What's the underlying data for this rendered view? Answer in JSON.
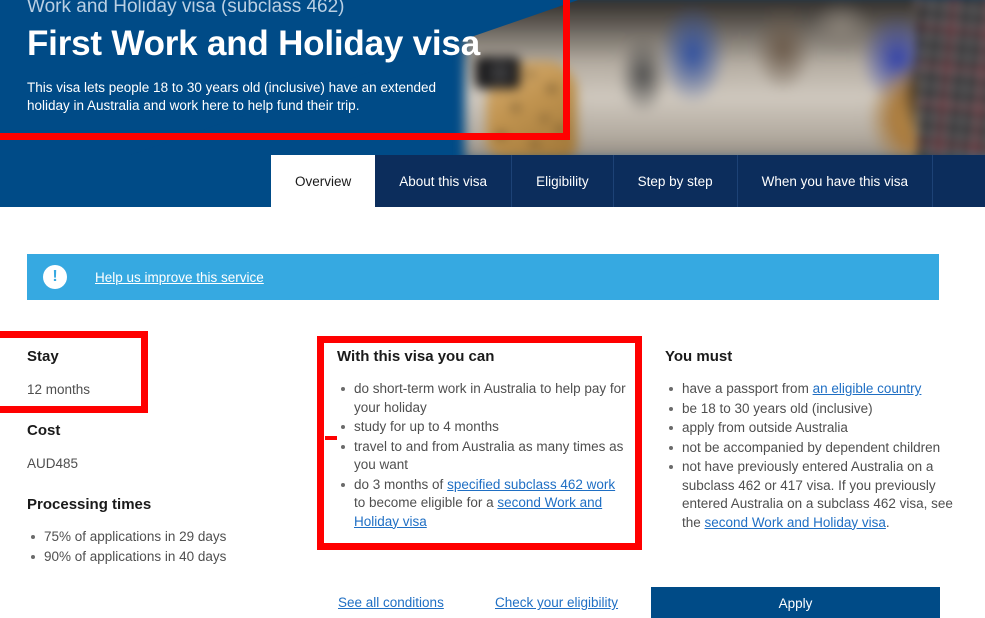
{
  "hero": {
    "eyebrow": "Work and Holiday visa (subclass 462)",
    "title": "First Work and Holiday visa",
    "subtitle": "This visa lets people 18 to 30 years old (inclusive) have an extended holiday in Australia and work here to help fund their trip."
  },
  "tabs": [
    {
      "label": "Overview",
      "active": true
    },
    {
      "label": "About this visa",
      "active": false
    },
    {
      "label": "Eligibility",
      "active": false
    },
    {
      "label": "Step by step",
      "active": false
    },
    {
      "label": "When you have this visa",
      "active": false
    }
  ],
  "alert": {
    "icon": "exclamation-icon",
    "link_label": "Help us improve this service"
  },
  "left_column": {
    "stay_heading": "Stay",
    "stay_value": "12 months",
    "cost_heading": "Cost",
    "cost_value": "AUD485",
    "processing_heading": "Processing times",
    "processing_items": [
      "75% of applications in 29 days",
      "90% of applications in 40 days"
    ]
  },
  "middle_column": {
    "heading": "With this visa you can",
    "items": [
      {
        "pre": "do short-term work in Australia to help pay for your holiday"
      },
      {
        "pre": "study for up to 4 months"
      },
      {
        "pre": "travel to and from Australia as many times as you want"
      },
      {
        "pre": "do 3 months of ",
        "link1": "specified subclass 462 work",
        "mid": " to become eligible for a ",
        "link2": "second Work and Holiday visa"
      }
    ]
  },
  "right_column": {
    "heading": "You must",
    "items": [
      {
        "pre": "have a passport from ",
        "link1": "an eligible country"
      },
      {
        "pre": "be 18 to 30 years old (inclusive)"
      },
      {
        "pre": "apply from outside Australia"
      },
      {
        "pre": "not be accompanied by dependent children"
      },
      {
        "pre": "not have previously entered Australia on a subclass 462 or 417 visa. If you previously entered Australia on a subclass 462 visa, see the ",
        "link1": "second Work and Holiday visa",
        "post": "."
      }
    ]
  },
  "actions": {
    "see_conditions": "See all conditions",
    "check_eligibility": "Check your eligibility",
    "apply": "Apply"
  },
  "colors": {
    "hero_blue": "#004b87",
    "tabbar_navy": "#0c2d5c",
    "alert_blue": "#36a9e1",
    "link_blue": "#1f6fc4",
    "annotation_red": "#ff0000"
  }
}
